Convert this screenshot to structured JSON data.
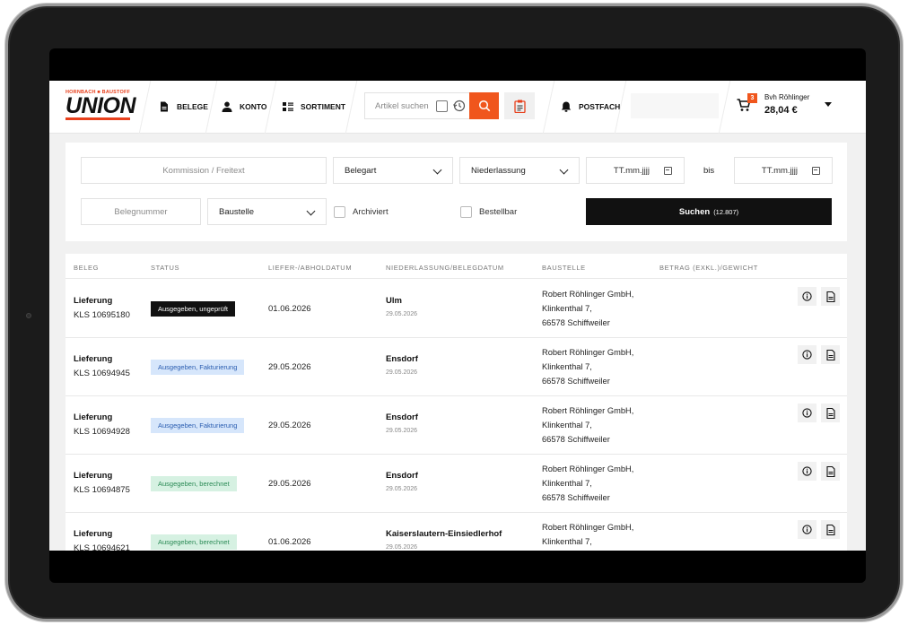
{
  "brand": {
    "top": "HORNBACH ■ BAUSTOFF",
    "main": "UNION"
  },
  "nav": {
    "belege": "BELEGE",
    "konto": "KONTO",
    "sortiment": "SORTIMENT",
    "postfach": "POSTFACH"
  },
  "search": {
    "placeholder": "Artikel suchen"
  },
  "cart": {
    "count": "3",
    "name": "Bvh Röhlinger",
    "total": "28,04 €"
  },
  "filters": {
    "kommission_placeholder": "Kommission / Freitext",
    "belegart": "Belegart",
    "niederlassung": "Niederlassung",
    "date_from": "TT.mm.jjjj",
    "date_to": "TT.mm.jjjj",
    "bis": "bis",
    "belegnummer_placeholder": "Belegnummer",
    "baustelle": "Baustelle",
    "archiviert": "Archiviert",
    "bestellbar": "Bestellbar",
    "submit": "Suchen",
    "submit_count": "(12.807)"
  },
  "table": {
    "headers": {
      "beleg": "BELEG",
      "status": "STATUS",
      "datum": "LIEFER-/ABHOLDATUM",
      "niederlassung": "NIEDERLASSUNG/BELEGDATUM",
      "baustelle": "BAUSTELLE",
      "betrag": "BETRAG (EXKL.)/GEWICHT"
    },
    "rows": [
      {
        "type": "Lieferung",
        "number": "KLS 10695180",
        "status": "Ausgegeben, ungeprüft",
        "status_style": "black",
        "date": "01.06.2026",
        "branch": "Ulm",
        "branch_date": "29.05.2026",
        "addr1": "Robert Röhlinger GmbH,",
        "addr2": "Klinkenthal 7,",
        "addr3": "66578 Schiffweiler"
      },
      {
        "type": "Lieferung",
        "number": "KLS 10694945",
        "status": "Ausgegeben, Fakturierung",
        "status_style": "blue",
        "date": "29.05.2026",
        "branch": "Ensdorf",
        "branch_date": "29.05.2026",
        "addr1": "Robert Röhlinger GmbH,",
        "addr2": "Klinkenthal 7,",
        "addr3": "66578 Schiffweiler"
      },
      {
        "type": "Lieferung",
        "number": "KLS 10694928",
        "status": "Ausgegeben, Fakturierung",
        "status_style": "blue",
        "date": "29.05.2026",
        "branch": "Ensdorf",
        "branch_date": "29.05.2026",
        "addr1": "Robert Röhlinger GmbH,",
        "addr2": "Klinkenthal 7,",
        "addr3": "66578 Schiffweiler"
      },
      {
        "type": "Lieferung",
        "number": "KLS 10694875",
        "status": "Ausgegeben, berechnet",
        "status_style": "green",
        "date": "29.05.2026",
        "branch": "Ensdorf",
        "branch_date": "29.05.2026",
        "addr1": "Robert Röhlinger GmbH,",
        "addr2": "Klinkenthal 7,",
        "addr3": "66578 Schiffweiler"
      },
      {
        "type": "Lieferung",
        "number": "KLS 10694621",
        "status": "Ausgegeben, berechnet",
        "status_style": "green",
        "date": "01.06.2026",
        "branch": "Kaiserslautern-Einsiedlerhof",
        "branch_date": "29.05.2026",
        "addr1": "Robert Röhlinger GmbH,",
        "addr2": "Klinkenthal 7,",
        "addr3": ""
      }
    ]
  },
  "colors": {
    "accent": "#f0561d",
    "dark": "#111111"
  }
}
